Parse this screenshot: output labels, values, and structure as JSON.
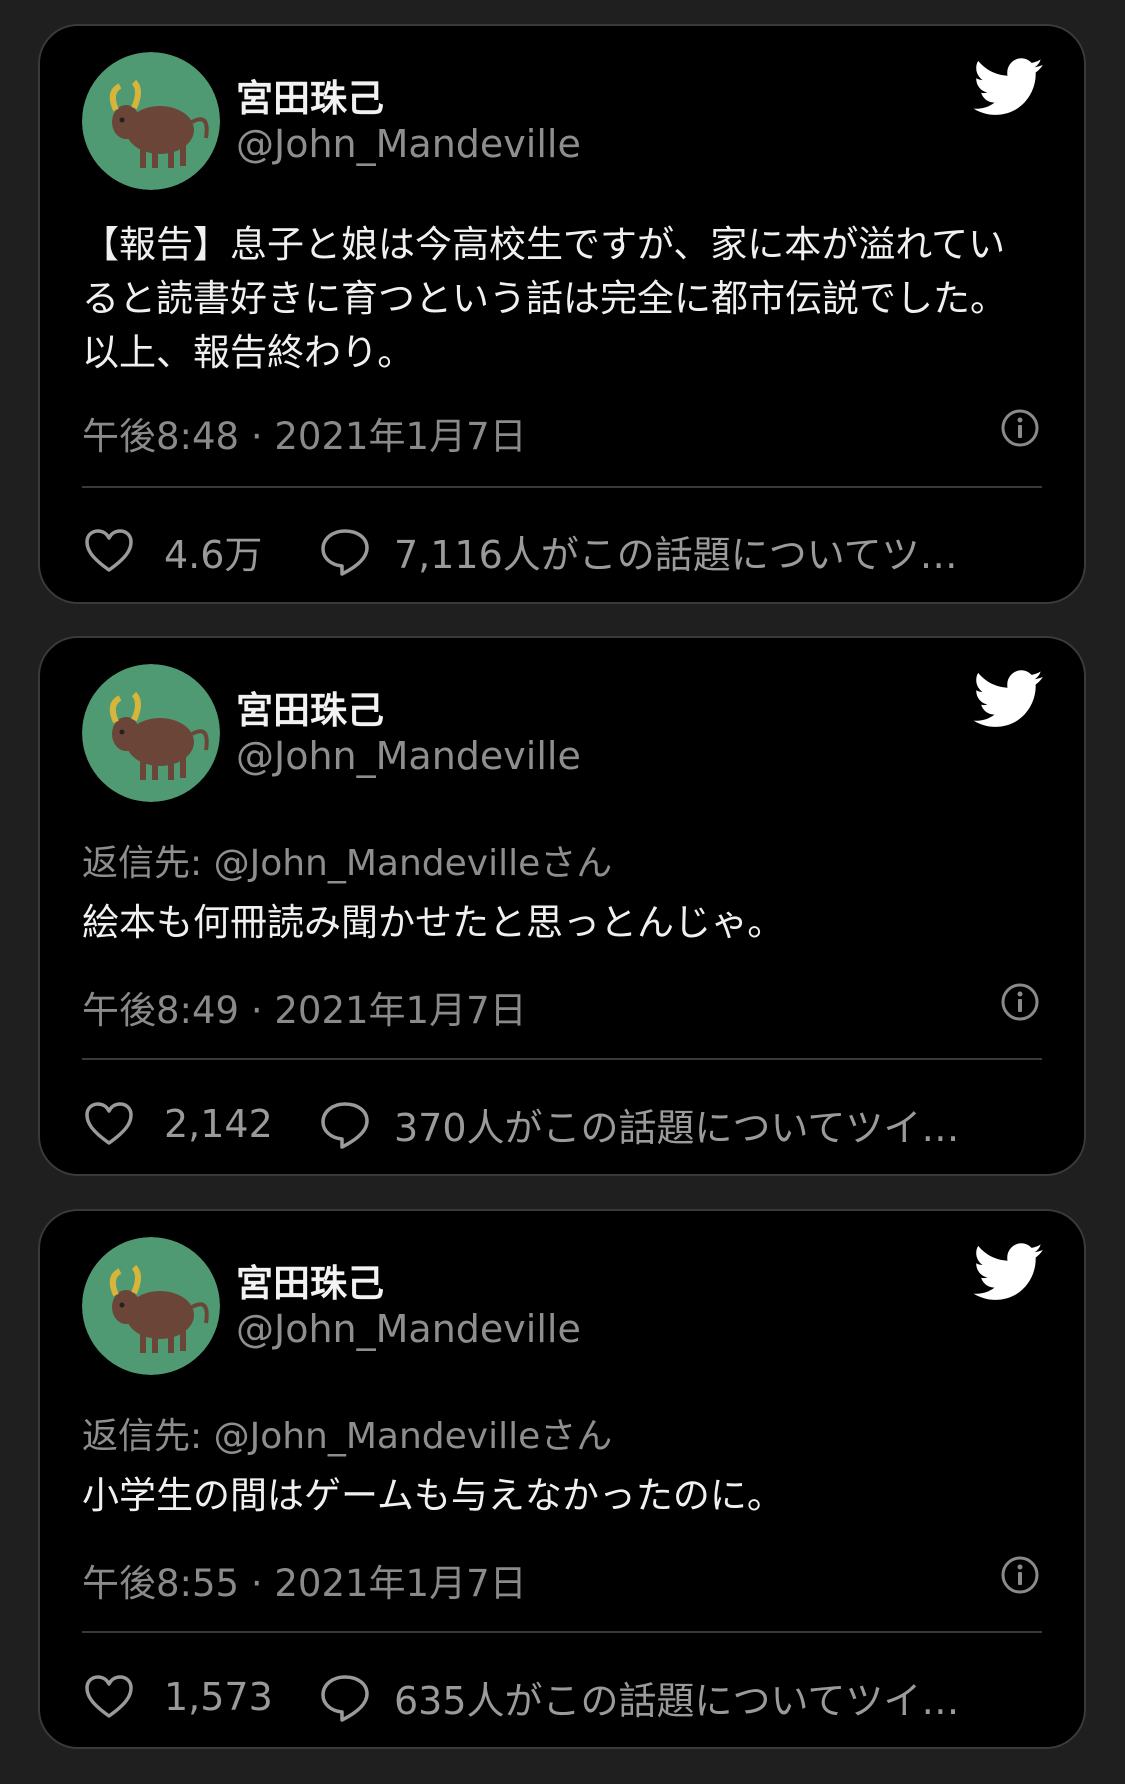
{
  "tweets": [
    {
      "display_name": "宮田珠己",
      "handle": "@John_Mandeville",
      "reply_to": "",
      "text": "【報告】息子と娘は今高校生ですが、家に本が溢れていると読書好きに育つという話は完全に都市伝説でした。以上、報告終わり。",
      "timestamp": "午後8:48 · 2021年1月7日",
      "likes": "4.6万",
      "conversation": "7,116人がこの話題についてツイ…"
    },
    {
      "display_name": "宮田珠己",
      "handle": "@John_Mandeville",
      "reply_to": "返信先: @John_Mandevilleさん",
      "text": "絵本も何冊読み聞かせたと思っとんじゃ。",
      "timestamp": "午後8:49 · 2021年1月7日",
      "likes": "2,142",
      "conversation": "370人がこの話題についてツイ…"
    },
    {
      "display_name": "宮田珠己",
      "handle": "@John_Mandeville",
      "reply_to": "返信先: @John_Mandevilleさん",
      "text": "小学生の間はゲームも与えなかったのに。",
      "timestamp": "午後8:55 · 2021年1月7日",
      "likes": "1,573",
      "conversation": "635人がこの話題についてツイ…"
    }
  ],
  "icons": {
    "brand": "twitter-bird-icon",
    "like": "heart-icon",
    "reply": "speech-bubble-icon",
    "info": "info-icon"
  },
  "colors": {
    "page_background": "#1f1f1f",
    "card_background": "#000000",
    "card_border": "#3a3a3a",
    "primary_text": "#f0f0f0",
    "secondary_text": "#8e8e8e",
    "avatar_background": "#4f9a72",
    "bull_body": "#6b4638",
    "bull_horn": "#d6b53a"
  }
}
